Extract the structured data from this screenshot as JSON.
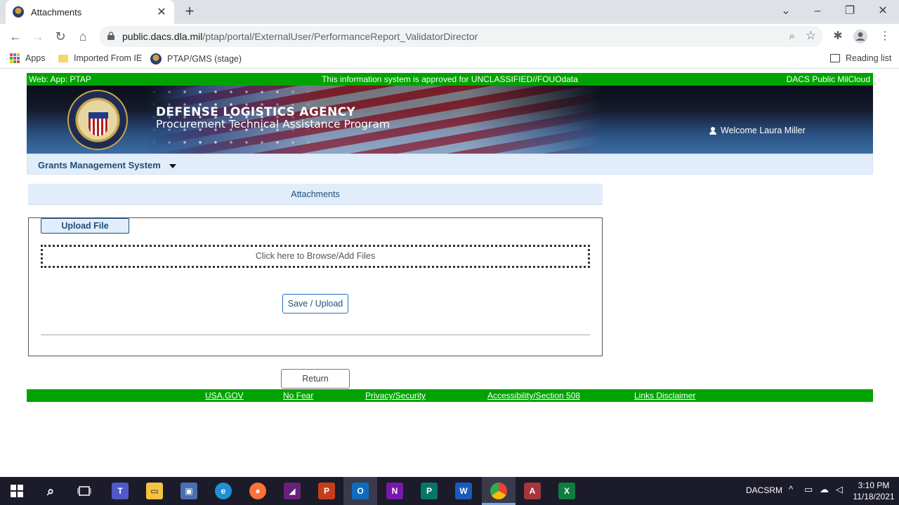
{
  "browser": {
    "tab_title": "Attachments",
    "url_host": "public.dacs.dla.mil",
    "url_path": "/ptap/portal/ExternalUser/PerformanceReport_ValidatorDirector",
    "bookmarks": {
      "apps": "Apps",
      "imported": "Imported From IE",
      "ptap": "PTAP/GMS (stage)",
      "reading_list": "Reading list"
    }
  },
  "page": {
    "top_bar": {
      "left": "Web: App: PTAP",
      "center": "This information system is approved for UNCLASSIFIED//FOUOdata",
      "right": "DACS Public MilCloud"
    },
    "banner": {
      "agency": "DEFENSE LOGISTICS AGENCY",
      "program": "Procurement Technical Assistance Program",
      "welcome": "Welcome Laura Miller"
    },
    "menu": {
      "gms": "Grants Management System"
    },
    "attachments": {
      "header": "Attachments",
      "upload_file": "Upload File",
      "dropzone": "Click here to Browse/Add Files",
      "save_upload": "Save / Upload",
      "return": "Return"
    },
    "footer_links": [
      "USA.GOV",
      "No Fear",
      "Privacy/Security",
      "Accessibility/Section 508",
      "Links Disclaimer"
    ]
  },
  "taskbar": {
    "tray_label": "DACSRM",
    "time": "3:10 PM",
    "date": "11/18/2021"
  },
  "colors": {
    "green_bar": "#00a300",
    "menu_bg": "#e1edfa",
    "link_blue": "#1f4e79"
  }
}
